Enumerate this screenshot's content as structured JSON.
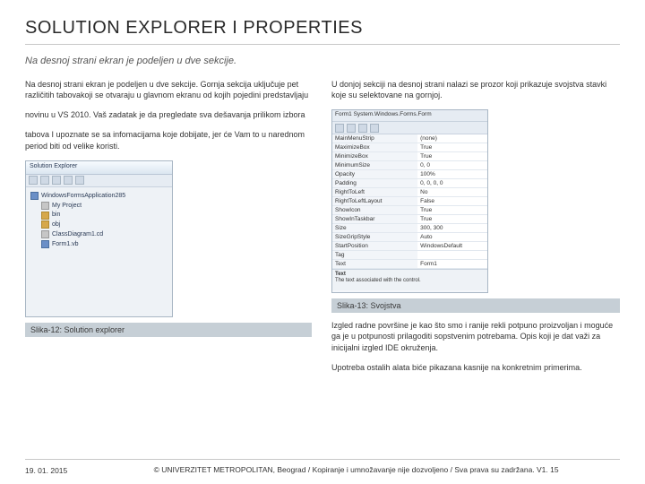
{
  "title": "SOLUTION EXPLORER I PROPERTIES",
  "intro": "Na  desnoj  strani  ekran  je  podeljen  u  dve  sekcije.",
  "left": {
    "p1": "Na  desnoj  strani  ekran  je  podeljen  u  dve  sekcije.  Gornja sekcija  uključuje  pet različitih tabovakoji se otvaraju u glavnom ekranu od kojih pojedini predstavljaju",
    "p2": "novinu  u  VS 2010.  Vaš  zadatak  je  da  pregledate  sva dešavanja prilikom  izbora",
    "p3": "tabova I upoznate se sa infomacijama koje dobijate, jer će Vam to u narednom period biti od velike koristi.",
    "fig_title": "Solution Explorer",
    "tree_root": "WindowsFormsApplication285",
    "tree_items": [
      "My Project",
      "bin",
      "obj",
      "ClassDiagram1.cd",
      "Form1.vb"
    ],
    "caption": "Slika-12: Solution explorer"
  },
  "right": {
    "p1": "U donjoj sekciji na desnoj strani nalazi se prozor koji prikazuje svojstva stavki koje su selektovane na gornjoj.",
    "prop_header": "Form1  System.Windows.Forms.Form",
    "props": [
      {
        "cat": null,
        "k": "MainMenuStrip",
        "v": "(none)"
      },
      {
        "cat": null,
        "k": "MaximizeBox",
        "v": "True"
      },
      {
        "cat": null,
        "k": "MinimizeBox",
        "v": "True"
      },
      {
        "cat": null,
        "k": "MinimumSize",
        "v": "0, 0"
      },
      {
        "cat": null,
        "k": "Opacity",
        "v": "100%"
      },
      {
        "cat": null,
        "k": "Padding",
        "v": "0, 0, 0, 0"
      },
      {
        "cat": null,
        "k": "RightToLeft",
        "v": "No"
      },
      {
        "cat": null,
        "k": "RightToLeftLayout",
        "v": "False"
      },
      {
        "cat": null,
        "k": "ShowIcon",
        "v": "True"
      },
      {
        "cat": null,
        "k": "ShowInTaskbar",
        "v": "True"
      },
      {
        "cat": null,
        "k": "Size",
        "v": "300, 300"
      },
      {
        "cat": null,
        "k": "SizeGripStyle",
        "v": "Auto"
      },
      {
        "cat": null,
        "k": "StartPosition",
        "v": "WindowsDefault"
      },
      {
        "cat": null,
        "k": "Tag",
        "v": ""
      },
      {
        "cat": null,
        "k": "Text",
        "v": "Form1"
      }
    ],
    "prop_footer_title": "Text",
    "prop_footer_desc": "The text associated with the control.",
    "caption": "Slika-13: Svojstva",
    "p2": "Izgled radne površine je kao što smo i ranije rekli potpuno proizvoljan i moguće ga je u potpunosti prilagoditi sopstvenim potrebama. Opis koji je dat važi za inicijalni izgled IDE okruženja.",
    "p3": "Upotreba ostalih alata biće pikazana kasnije na konkretnim primerima."
  },
  "footer": {
    "date": "19. 01. 2015",
    "copy": "© UNIVERZITET METROPOLITAN, Beograd / Kopiranje i umnožavanje nije dozvoljeno / Sva prava su zadržana. V1. 15"
  }
}
